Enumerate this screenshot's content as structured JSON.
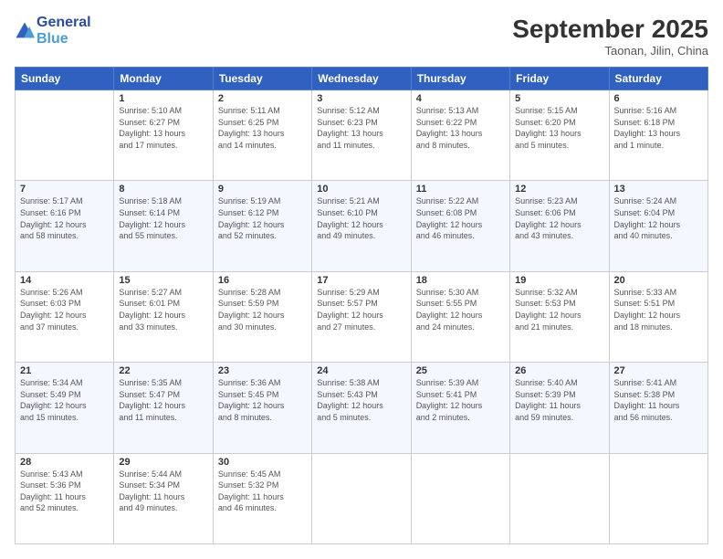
{
  "header": {
    "logo_line1": "General",
    "logo_line2": "Blue",
    "month_title": "September 2025",
    "location": "Taonan, Jilin, China"
  },
  "weekdays": [
    "Sunday",
    "Monday",
    "Tuesday",
    "Wednesday",
    "Thursday",
    "Friday",
    "Saturday"
  ],
  "weeks": [
    [
      {
        "day": "",
        "info": ""
      },
      {
        "day": "1",
        "info": "Sunrise: 5:10 AM\nSunset: 6:27 PM\nDaylight: 13 hours\nand 17 minutes."
      },
      {
        "day": "2",
        "info": "Sunrise: 5:11 AM\nSunset: 6:25 PM\nDaylight: 13 hours\nand 14 minutes."
      },
      {
        "day": "3",
        "info": "Sunrise: 5:12 AM\nSunset: 6:23 PM\nDaylight: 13 hours\nand 11 minutes."
      },
      {
        "day": "4",
        "info": "Sunrise: 5:13 AM\nSunset: 6:22 PM\nDaylight: 13 hours\nand 8 minutes."
      },
      {
        "day": "5",
        "info": "Sunrise: 5:15 AM\nSunset: 6:20 PM\nDaylight: 13 hours\nand 5 minutes."
      },
      {
        "day": "6",
        "info": "Sunrise: 5:16 AM\nSunset: 6:18 PM\nDaylight: 13 hours\nand 1 minute."
      }
    ],
    [
      {
        "day": "7",
        "info": "Sunrise: 5:17 AM\nSunset: 6:16 PM\nDaylight: 12 hours\nand 58 minutes."
      },
      {
        "day": "8",
        "info": "Sunrise: 5:18 AM\nSunset: 6:14 PM\nDaylight: 12 hours\nand 55 minutes."
      },
      {
        "day": "9",
        "info": "Sunrise: 5:19 AM\nSunset: 6:12 PM\nDaylight: 12 hours\nand 52 minutes."
      },
      {
        "day": "10",
        "info": "Sunrise: 5:21 AM\nSunset: 6:10 PM\nDaylight: 12 hours\nand 49 minutes."
      },
      {
        "day": "11",
        "info": "Sunrise: 5:22 AM\nSunset: 6:08 PM\nDaylight: 12 hours\nand 46 minutes."
      },
      {
        "day": "12",
        "info": "Sunrise: 5:23 AM\nSunset: 6:06 PM\nDaylight: 12 hours\nand 43 minutes."
      },
      {
        "day": "13",
        "info": "Sunrise: 5:24 AM\nSunset: 6:04 PM\nDaylight: 12 hours\nand 40 minutes."
      }
    ],
    [
      {
        "day": "14",
        "info": "Sunrise: 5:26 AM\nSunset: 6:03 PM\nDaylight: 12 hours\nand 37 minutes."
      },
      {
        "day": "15",
        "info": "Sunrise: 5:27 AM\nSunset: 6:01 PM\nDaylight: 12 hours\nand 33 minutes."
      },
      {
        "day": "16",
        "info": "Sunrise: 5:28 AM\nSunset: 5:59 PM\nDaylight: 12 hours\nand 30 minutes."
      },
      {
        "day": "17",
        "info": "Sunrise: 5:29 AM\nSunset: 5:57 PM\nDaylight: 12 hours\nand 27 minutes."
      },
      {
        "day": "18",
        "info": "Sunrise: 5:30 AM\nSunset: 5:55 PM\nDaylight: 12 hours\nand 24 minutes."
      },
      {
        "day": "19",
        "info": "Sunrise: 5:32 AM\nSunset: 5:53 PM\nDaylight: 12 hours\nand 21 minutes."
      },
      {
        "day": "20",
        "info": "Sunrise: 5:33 AM\nSunset: 5:51 PM\nDaylight: 12 hours\nand 18 minutes."
      }
    ],
    [
      {
        "day": "21",
        "info": "Sunrise: 5:34 AM\nSunset: 5:49 PM\nDaylight: 12 hours\nand 15 minutes."
      },
      {
        "day": "22",
        "info": "Sunrise: 5:35 AM\nSunset: 5:47 PM\nDaylight: 12 hours\nand 11 minutes."
      },
      {
        "day": "23",
        "info": "Sunrise: 5:36 AM\nSunset: 5:45 PM\nDaylight: 12 hours\nand 8 minutes."
      },
      {
        "day": "24",
        "info": "Sunrise: 5:38 AM\nSunset: 5:43 PM\nDaylight: 12 hours\nand 5 minutes."
      },
      {
        "day": "25",
        "info": "Sunrise: 5:39 AM\nSunset: 5:41 PM\nDaylight: 12 hours\nand 2 minutes."
      },
      {
        "day": "26",
        "info": "Sunrise: 5:40 AM\nSunset: 5:39 PM\nDaylight: 11 hours\nand 59 minutes."
      },
      {
        "day": "27",
        "info": "Sunrise: 5:41 AM\nSunset: 5:38 PM\nDaylight: 11 hours\nand 56 minutes."
      }
    ],
    [
      {
        "day": "28",
        "info": "Sunrise: 5:43 AM\nSunset: 5:36 PM\nDaylight: 11 hours\nand 52 minutes."
      },
      {
        "day": "29",
        "info": "Sunrise: 5:44 AM\nSunset: 5:34 PM\nDaylight: 11 hours\nand 49 minutes."
      },
      {
        "day": "30",
        "info": "Sunrise: 5:45 AM\nSunset: 5:32 PM\nDaylight: 11 hours\nand 46 minutes."
      },
      {
        "day": "",
        "info": ""
      },
      {
        "day": "",
        "info": ""
      },
      {
        "day": "",
        "info": ""
      },
      {
        "day": "",
        "info": ""
      }
    ]
  ]
}
